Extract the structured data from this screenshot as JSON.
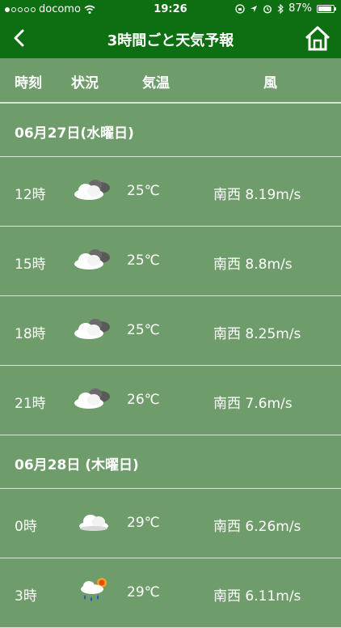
{
  "status_bar": {
    "carrier": "docomo",
    "time": "19:26",
    "battery": "87%",
    "battery_level": 0.87
  },
  "navbar": {
    "back_icon": "chevron-left-icon",
    "title": "3時間ごと天気予報",
    "home_icon": "home-icon"
  },
  "columns": {
    "time": "時刻",
    "condition": "状況",
    "temperature": "気温",
    "wind": "風"
  },
  "days": [
    {
      "date": "06月27日(水曜日)",
      "rows": [
        {
          "time": "12時",
          "icon": "cloudy-icon",
          "temp": "25℃",
          "wind": "南西 8.19m/s"
        },
        {
          "time": "15時",
          "icon": "cloudy-icon",
          "temp": "25℃",
          "wind": "南西 8.8m/s"
        },
        {
          "time": "18時",
          "icon": "cloudy-icon",
          "temp": "25℃",
          "wind": "南西 8.25m/s"
        },
        {
          "time": "21時",
          "icon": "cloudy-icon",
          "temp": "26℃",
          "wind": "南西 7.6m/s"
        }
      ]
    },
    {
      "date": "06月28日 (木曜日)",
      "rows": [
        {
          "time": "0時",
          "icon": "cloud-icon",
          "temp": "29℃",
          "wind": "南西 6.26m/s"
        },
        {
          "time": "3時",
          "icon": "rain-sun-icon",
          "temp": "29℃",
          "wind": "南西 6.11m/s"
        }
      ]
    }
  ]
}
